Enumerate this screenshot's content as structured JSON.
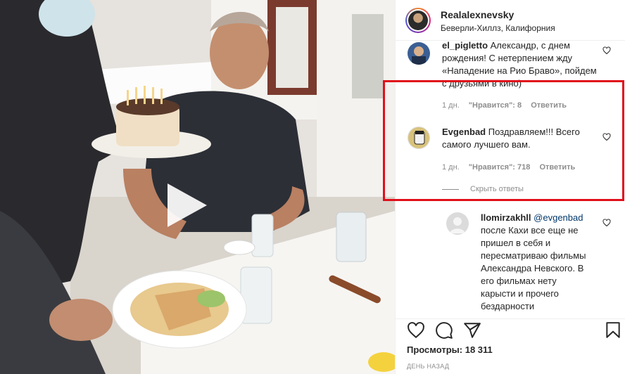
{
  "header": {
    "username": "Realalexnevsky",
    "location": "Беверли-Хиллз, Калифорния"
  },
  "comments": [
    {
      "user": "el_pigletto",
      "text": "Александр, с днем рождения! С нетерпением жду «Нападение на Рио Браво», пойдем с друзьями в кино)",
      "time": "1 дн.",
      "likes": "\"Нравится\": 8",
      "reply": "Ответить"
    },
    {
      "user": "Evgenbad",
      "text": "Поздравляем!!! Всего самого лучшего вам.",
      "time": "1 дн.",
      "likes": "\"Нравится\": 718",
      "reply": "Ответить"
    },
    {
      "user": "llomirzakhll",
      "mention": "@evgenbad",
      "text": "после Кахи все еще не пришел в себя и пересматриваю фильмы Александра Невского. В его фильмах нету карысти и прочего бездарности"
    }
  ],
  "hide_replies": "Скрыть ответы",
  "actions": {
    "icons": [
      "heart-icon",
      "comment-icon",
      "share-icon",
      "bookmark-icon"
    ],
    "views_label": "Просмотры:",
    "views_count": "18 311",
    "timestamp": "ДЕНЬ НАЗАД"
  },
  "colors": {
    "highlight": "#e0101b",
    "text": "#262626",
    "secondary": "#8e8e8e",
    "mention": "#00376b"
  }
}
